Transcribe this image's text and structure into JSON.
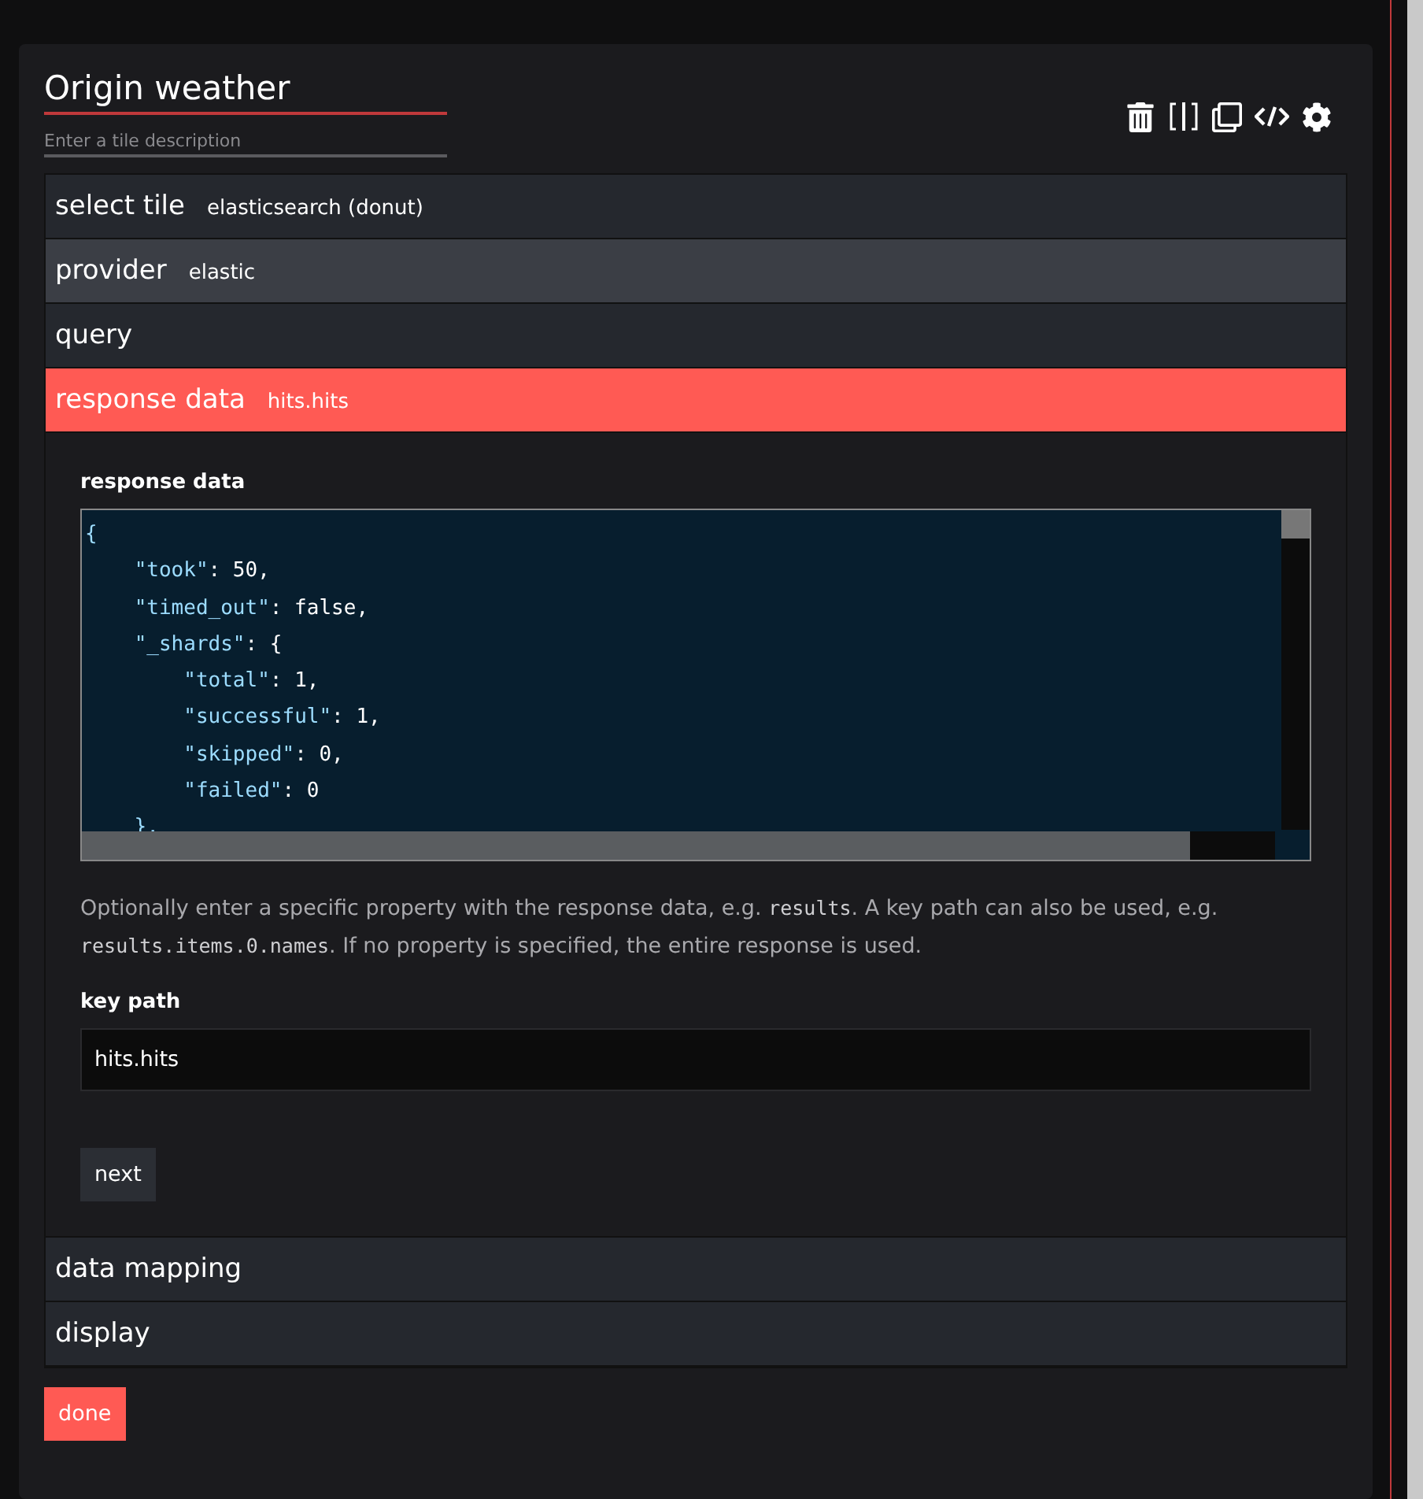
{
  "tile": {
    "title": "Origin weather",
    "description_placeholder": "Enter a tile description"
  },
  "toolbar": [
    {
      "kind": "delete"
    },
    {
      "kind": "split"
    },
    {
      "kind": "duplicate"
    },
    {
      "kind": "code"
    },
    {
      "kind": "settings"
    }
  ],
  "sections": [
    {
      "label": "select tile",
      "value": "elasticsearch (donut)",
      "expanded": false,
      "hovered": false
    },
    {
      "label": "provider",
      "value": "elastic",
      "expanded": false,
      "hovered": true
    },
    {
      "label": "query",
      "expanded": false,
      "hovered": false
    },
    {
      "label": "response data",
      "value": "hits.hits",
      "expanded": true,
      "hovered": false
    },
    {
      "label": "data mapping",
      "expanded": false,
      "hovered": false
    },
    {
      "label": "display",
      "expanded": false,
      "hovered": false
    }
  ],
  "response_panel": {
    "editor_label": "response data",
    "code_lines": [
      "{",
      "    \"took\": 50,",
      "    \"timed_out\": false,",
      "    \"_shards\": {",
      "        \"total\": 1,",
      "        \"successful\": 1,",
      "        \"skipped\": 0,",
      "        \"failed\": 0",
      "    },"
    ],
    "help": [
      {
        "text": "Optionally enter a specific property with the response data, e.g. ",
        "code": false
      },
      {
        "text": "results",
        "code": true
      },
      {
        "text": ". A key path can also be used, e.g. ",
        "code": false
      },
      {
        "text": "results.items.0.names",
        "code": true
      },
      {
        "text": ". If no property is specified, the entire response is used.",
        "code": false
      }
    ],
    "key_path_label": "key path",
    "key_path_value": "hits.hits",
    "next_button": "next"
  },
  "done_button": "done"
}
